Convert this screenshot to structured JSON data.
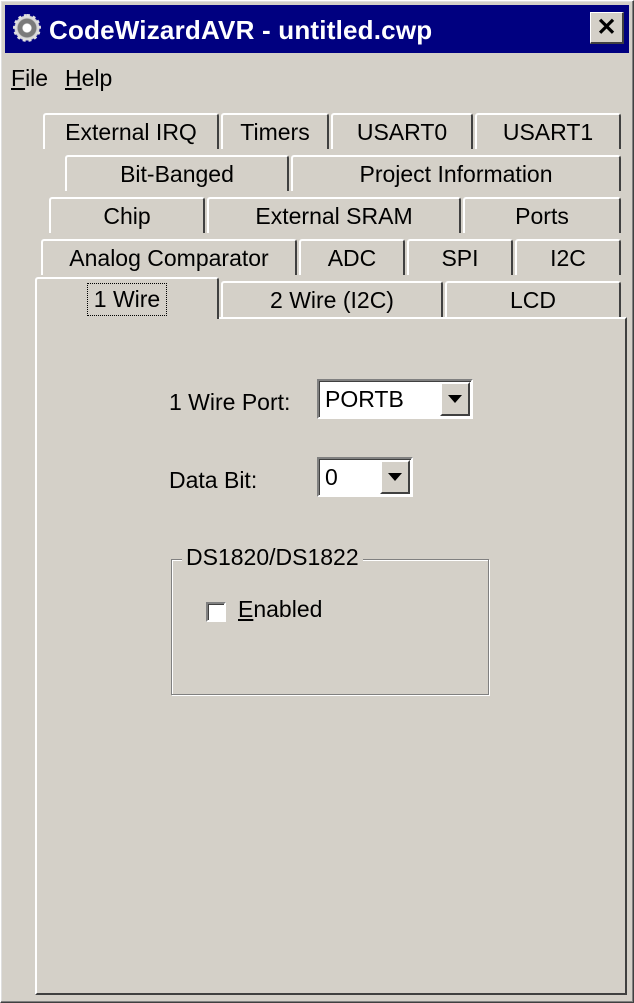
{
  "window": {
    "title": "CodeWizardAVR - untitled.cwp",
    "close_glyph": "✕"
  },
  "menu": {
    "file": {
      "accel": "F",
      "rest": "ile"
    },
    "help": {
      "accel": "H",
      "rest": "elp"
    }
  },
  "tabs": {
    "row1": [
      "External IRQ",
      "Timers",
      "USART0",
      "USART1"
    ],
    "row2": [
      "Bit-Banged",
      "Project Information"
    ],
    "row3": [
      "Chip",
      "External SRAM",
      "Ports"
    ],
    "row4": [
      "Analog Comparator",
      "ADC",
      "SPI",
      "I2C"
    ],
    "row5": [
      "1 Wire",
      "2 Wire (I2C)",
      "LCD"
    ],
    "selected": "1 Wire"
  },
  "one_wire": {
    "port_label": "1 Wire Port:",
    "port_value": "PORTB",
    "bit_label": "Data Bit:",
    "bit_value": "0",
    "group_title": "DS1820/DS1822",
    "enabled_accel": "E",
    "enabled_rest": "nabled",
    "enabled_checked": false
  },
  "icons": {
    "app": "gear-icon",
    "dropdown": "triangle-down-icon"
  },
  "colors": {
    "titlebar": "#000080",
    "face": "#d4d0c8"
  }
}
